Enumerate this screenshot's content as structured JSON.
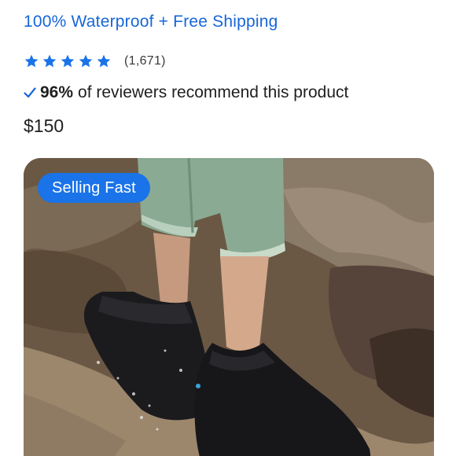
{
  "product": {
    "subtitle": "100% Waterproof + Free Shipping",
    "rating": {
      "stars": 5,
      "count_label": "(1,671)"
    },
    "recommend": {
      "percent": "96%",
      "text": "of reviewers recommend this product"
    },
    "price": "$150"
  },
  "image": {
    "badge_label": "Selling Fast"
  },
  "colors": {
    "accent": "#1666d8",
    "badge": "#1a73e8",
    "star": "#1a73e8"
  }
}
